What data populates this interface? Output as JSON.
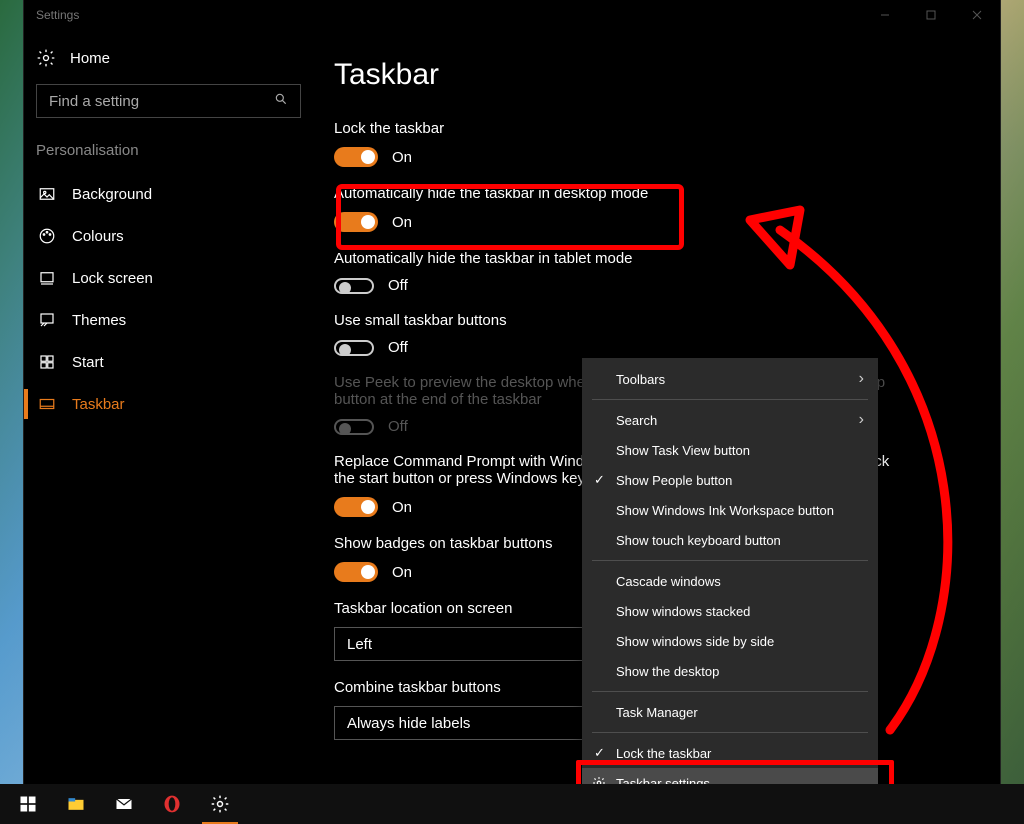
{
  "window": {
    "title": "Settings"
  },
  "sidebar": {
    "home": "Home",
    "search_placeholder": "Find a setting",
    "category": "Personalisation",
    "items": [
      {
        "label": "Background"
      },
      {
        "label": "Colours"
      },
      {
        "label": "Lock screen"
      },
      {
        "label": "Themes"
      },
      {
        "label": "Start"
      },
      {
        "label": "Taskbar"
      }
    ]
  },
  "page": {
    "title": "Taskbar",
    "opts": [
      {
        "label": "Lock the taskbar",
        "state": "On",
        "on": true
      },
      {
        "label": "Automatically hide the taskbar in desktop mode",
        "state": "On",
        "on": true
      },
      {
        "label": "Automatically hide the taskbar in tablet mode",
        "state": "Off",
        "on": false
      },
      {
        "label": "Use small taskbar buttons",
        "state": "Off",
        "on": false
      },
      {
        "label": "Use Peek to preview the desktop when you move your mouse to the Show desktop button at the end of the taskbar",
        "state": "Off",
        "on": false,
        "disabled": true
      },
      {
        "label": "Replace Command Prompt with Windows PowerShell in the menu when I right-click the start button or press Windows key+X",
        "state": "On",
        "on": true
      },
      {
        "label": "Show badges on taskbar buttons",
        "state": "On",
        "on": true
      }
    ],
    "location_label": "Taskbar location on screen",
    "location_value": "Left",
    "combine_label": "Combine taskbar buttons",
    "combine_value": "Always hide labels"
  },
  "context": {
    "items": [
      {
        "label": "Toolbars",
        "sub": true
      },
      {
        "label": "Search",
        "sub": true
      },
      {
        "label": "Show Task View button"
      },
      {
        "label": "Show People button",
        "checked": true
      },
      {
        "label": "Show Windows Ink Workspace button"
      },
      {
        "label": "Show touch keyboard button"
      }
    ],
    "group2": [
      {
        "label": "Cascade windows"
      },
      {
        "label": "Show windows stacked"
      },
      {
        "label": "Show windows side by side"
      },
      {
        "label": "Show the desktop"
      }
    ],
    "group3": [
      {
        "label": "Task Manager"
      }
    ],
    "group4": [
      {
        "label": "Lock the taskbar",
        "checked": true
      },
      {
        "label": "Taskbar settings",
        "gear": true,
        "highlight": true
      }
    ]
  },
  "colors": {
    "accent": "#e87b1c",
    "highlight": "#ff0000"
  }
}
